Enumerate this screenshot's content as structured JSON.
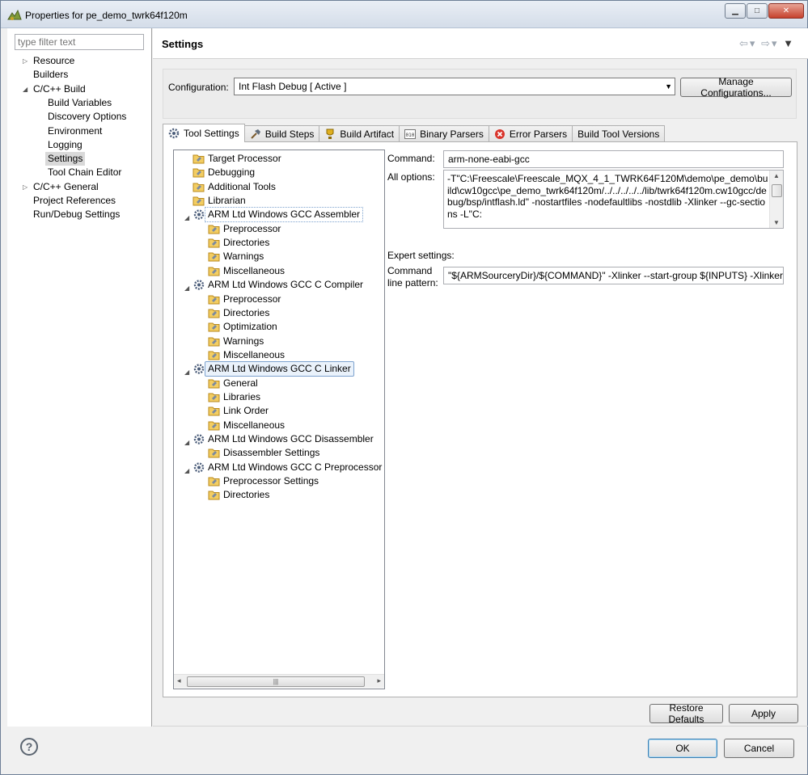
{
  "window": {
    "title": "Properties for pe_demo_twrk64f120m",
    "controls": [
      "minimize",
      "maximize",
      "close"
    ]
  },
  "filter": {
    "placeholder": "type filter text"
  },
  "sidebar": {
    "items": [
      {
        "label": "Resource"
      },
      {
        "label": "Builders"
      },
      {
        "label": "C/C++ Build"
      },
      {
        "label": "Build Variables"
      },
      {
        "label": "Discovery Options"
      },
      {
        "label": "Environment"
      },
      {
        "label": "Logging"
      },
      {
        "label": "Settings"
      },
      {
        "label": "Tool Chain Editor"
      },
      {
        "label": "C/C++ General"
      },
      {
        "label": "Project References"
      },
      {
        "label": "Run/Debug Settings"
      }
    ],
    "selected": "Settings"
  },
  "header": {
    "title": "Settings"
  },
  "config": {
    "label": "Configuration:",
    "value": "Int Flash Debug  [ Active ]",
    "manage_label": "Manage Configurations..."
  },
  "tabs": [
    {
      "label": "Tool Settings",
      "icon": "gear-icon"
    },
    {
      "label": "Build Steps",
      "icon": "hammer-icon"
    },
    {
      "label": "Build Artifact",
      "icon": "trophy-icon"
    },
    {
      "label": "Binary Parsers",
      "icon": "binary-icon"
    },
    {
      "label": "Error Parsers",
      "icon": "error-icon"
    },
    {
      "label": "Build Tool Versions",
      "icon": ""
    }
  ],
  "tree": [
    {
      "label": "Target Processor"
    },
    {
      "label": "Debugging"
    },
    {
      "label": "Additional Tools"
    },
    {
      "label": "Librarian"
    },
    {
      "label": "ARM Ltd Windows GCC Assembler"
    },
    {
      "label": "Preprocessor"
    },
    {
      "label": "Directories"
    },
    {
      "label": "Warnings"
    },
    {
      "label": "Miscellaneous"
    },
    {
      "label": "ARM Ltd Windows GCC C Compiler"
    },
    {
      "label": "Preprocessor"
    },
    {
      "label": "Directories"
    },
    {
      "label": "Optimization"
    },
    {
      "label": "Warnings"
    },
    {
      "label": "Miscellaneous"
    },
    {
      "label": "ARM Ltd Windows GCC C Linker"
    },
    {
      "label": "General"
    },
    {
      "label": "Libraries"
    },
    {
      "label": "Link Order"
    },
    {
      "label": "Miscellaneous"
    },
    {
      "label": "ARM Ltd Windows GCC Disassembler"
    },
    {
      "label": "Disassembler Settings"
    },
    {
      "label": "ARM Ltd Windows GCC C Preprocessor"
    },
    {
      "label": "Preprocessor Settings"
    },
    {
      "label": "Directories"
    }
  ],
  "tree_selected": "ARM Ltd Windows GCC C Linker",
  "settings": {
    "command_label": "Command:",
    "command_value": "arm-none-eabi-gcc",
    "all_options_label": "All options:",
    "all_options_value": "-T\"C:\\Freescale\\Freescale_MQX_4_1_TWRK64F120M\\demo\\pe_demo\\build\\cw10gcc\\pe_demo_twrk64f120m/../../../../../lib/twrk64f120m.cw10gcc/debug/bsp/intflash.ld\" -nostartfiles -nodefaultlibs -nostdlib -Xlinker --gc-sections -L\"C:",
    "expert_label": "Expert settings:",
    "pattern_label_1": "Command",
    "pattern_label_2": "line pattern:",
    "pattern_value": "\"${ARMSourceryDir}/${COMMAND}\" -Xlinker --start-group ${INPUTS} -Xlinker --end-group"
  },
  "buttons": {
    "restore_defaults": "Restore Defaults",
    "apply": "Apply",
    "ok": "OK",
    "cancel": "Cancel",
    "help": "?"
  },
  "colors": {
    "selection_border": "#7da2ce",
    "selection_fill": "#eaf2fb",
    "default_button_border": "#3c7fb1"
  }
}
